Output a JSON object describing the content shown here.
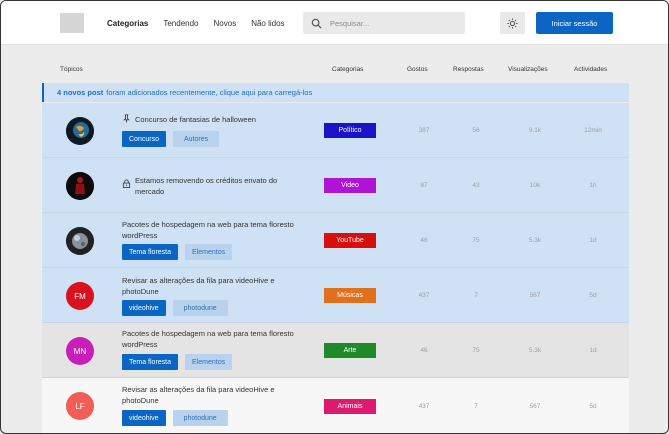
{
  "header": {
    "nav": [
      "Categorias",
      "Tendendo",
      "Novos",
      "Não lidos"
    ],
    "search_placeholder": "Pesquisar...",
    "login_label": "Iniciar sessão"
  },
  "columns": {
    "topics": "Tópicos",
    "categories": "Categorias",
    "likes": "Gostos",
    "replies": "Respostas",
    "views": "Visualizações",
    "activity": "Actividades"
  },
  "notice": {
    "bold": "4 novos post",
    "text": "foram adicionados recentemente, clique aqui para carregá-los"
  },
  "rows": [
    {
      "avatar": "",
      "icon": "pin-icon",
      "title": "Concurso de fantasias de halloween",
      "tags": [
        "Concurso",
        "Autores"
      ],
      "category": "Político",
      "cat_color": "#1a13c7",
      "likes": "387",
      "replies": "56",
      "views": "9.1k",
      "activity": "12min"
    },
    {
      "avatar": "",
      "icon": "lock-icon",
      "title": "Estamos removendo os créditos envato do mercado",
      "tags": [],
      "category": "Video",
      "cat_color": "#b012d6",
      "likes": "87",
      "replies": "43",
      "views": "10k",
      "activity": "1h"
    },
    {
      "avatar": "",
      "icon": "",
      "title": "Pacotes de hospedagem na web para tema floresto wordPress",
      "tags": [
        "Tema floresta",
        "Elementos"
      ],
      "category": "YouTube",
      "cat_color": "#d90e0e",
      "likes": "46",
      "replies": "75",
      "views": "5.3k",
      "activity": "1d"
    },
    {
      "avatar": "FM",
      "icon": "",
      "title": "Revisar as alterações da fila para videoHive e photoDune",
      "tags": [
        "videohive",
        "photodune"
      ],
      "category": "Músicas",
      "cat_color": "#e0701a",
      "likes": "437",
      "replies": "7",
      "views": "567",
      "activity": "5d"
    },
    {
      "avatar": "MN",
      "icon": "",
      "title": "Pacotes de hospedagem na web para tema floresto wordPress",
      "tags": [
        "Tema floresta",
        "Elementos"
      ],
      "category": "Arte",
      "cat_color": "#1e8a2a",
      "likes": "46",
      "replies": "75",
      "views": "5.3k",
      "activity": "1d"
    },
    {
      "avatar": "LF",
      "icon": "",
      "title": "Revisar as alterações da fila para videoHive e photoDune",
      "tags": [
        "videohive",
        "photodune"
      ],
      "category": "Animais",
      "cat_color": "#de1a6f",
      "likes": "437",
      "replies": "7",
      "views": "567",
      "activity": "5d"
    }
  ],
  "colors": {
    "accent": "#0a66c2",
    "avatar_fm": "#d9121f",
    "avatar_mn": "#c81fb9",
    "avatar_lf": "#f25d55"
  }
}
